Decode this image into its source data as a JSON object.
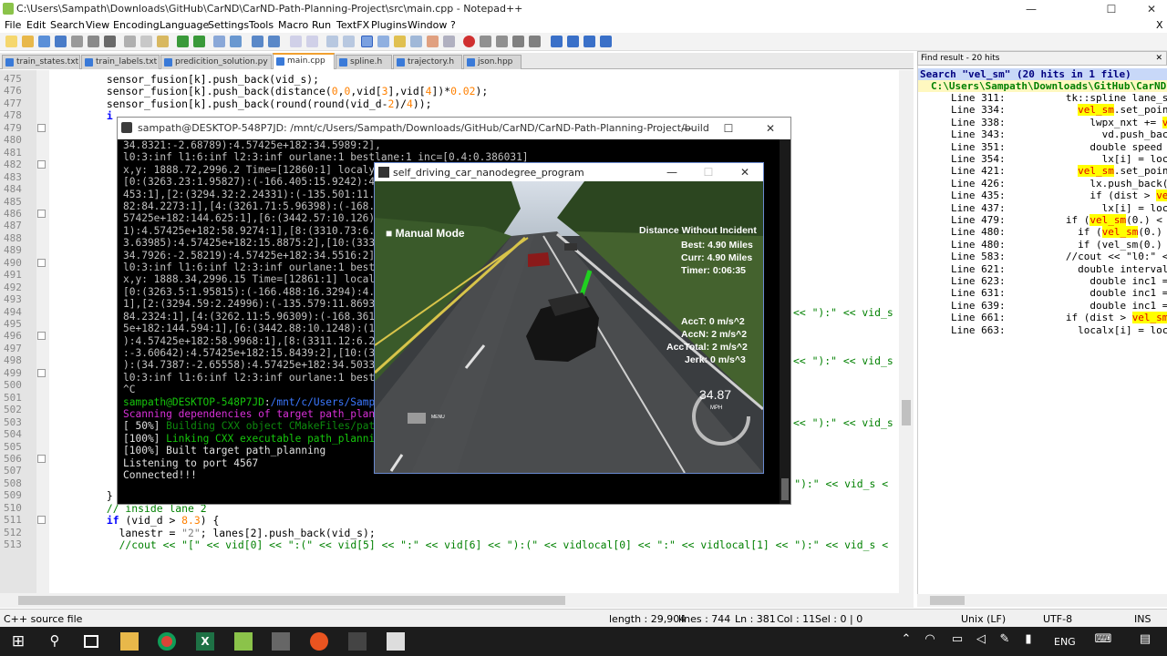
{
  "window": {
    "title": "C:\\Users\\Sampath\\Downloads\\GitHub\\CarND\\CarND-Path-Planning-Project\\src\\main.cpp - Notepad++",
    "minimize": "—",
    "maximize": "☐",
    "close": "✕",
    "extra_close": "X"
  },
  "menu": [
    "File",
    "Edit",
    "Search",
    "View",
    "Encoding",
    "Language",
    "Settings",
    "Tools",
    "Macro",
    "Run",
    "TextFX",
    "Plugins",
    "Window",
    "?"
  ],
  "tabs": [
    "train_states.txt",
    "train_labels.txt",
    "predicition_solution.py",
    "main.cpp",
    "spline.h",
    "trajectory.h",
    "json.hpp"
  ],
  "editor": {
    "lines": [
      {
        "n": "475",
        "segs": [
          [
            "",
            "        sensor_fusion[k].push_back(vid_s);"
          ]
        ]
      },
      {
        "n": "476",
        "segs": [
          [
            "",
            "        sensor_fusion[k].push_back(distance("
          ],
          [
            "nm",
            "0"
          ],
          [
            "",
            ","
          ],
          [
            "nm",
            "0"
          ],
          [
            "",
            ",vid["
          ],
          [
            "nm",
            "3"
          ],
          [
            "",
            "],vid["
          ],
          [
            "nm",
            "4"
          ],
          [
            "",
            "])*"
          ],
          [
            "nm",
            "0.02"
          ],
          [
            "",
            ");"
          ]
        ]
      },
      {
        "n": "477",
        "segs": [
          [
            "",
            "        sensor_fusion[k].push_back(round(round(vid_d-"
          ],
          [
            "nm",
            "2"
          ],
          [
            "",
            ")/"
          ],
          [
            "nm",
            "4"
          ],
          [
            "",
            "));"
          ]
        ]
      },
      {
        "n": "478",
        "segs": [
          [
            "",
            "        "
          ],
          [
            "kw",
            "i"
          ]
        ]
      },
      {
        "n": "479",
        "segs": []
      },
      {
        "n": "480",
        "segs": []
      },
      {
        "n": "481",
        "segs": []
      },
      {
        "n": "482",
        "segs": []
      },
      {
        "n": "483",
        "segs": []
      },
      {
        "n": "484",
        "segs": []
      },
      {
        "n": "485",
        "segs": []
      },
      {
        "n": "486",
        "segs": []
      },
      {
        "n": "487",
        "segs": []
      },
      {
        "n": "488",
        "segs": []
      },
      {
        "n": "489",
        "segs": []
      },
      {
        "n": "490",
        "segs": []
      },
      {
        "n": "491",
        "segs": []
      },
      {
        "n": "492",
        "segs": []
      },
      {
        "n": "493",
        "segs": []
      },
      {
        "n": "494",
        "segs": []
      },
      {
        "n": "495",
        "segs": []
      },
      {
        "n": "496",
        "segs": []
      },
      {
        "n": "497",
        "segs": []
      },
      {
        "n": "498",
        "segs": []
      },
      {
        "n": "499",
        "segs": []
      },
      {
        "n": "500",
        "segs": []
      },
      {
        "n": "501",
        "segs": []
      },
      {
        "n": "502",
        "segs": []
      },
      {
        "n": "503",
        "segs": []
      },
      {
        "n": "504",
        "segs": []
      },
      {
        "n": "505",
        "segs": []
      },
      {
        "n": "506",
        "segs": []
      },
      {
        "n": "507",
        "segs": [
          [
            "",
            "          lanestr = "
          ],
          [
            "st",
            "\"1,2\""
          ],
          [
            "",
            "; lanes[1].push_back(vid_s); lanes[2].push_back(vid_s);"
          ]
        ]
      },
      {
        "n": "508",
        "segs": [
          [
            "cm",
            "          //cout << \"[\" << vid[0] << \":(\" << vid[5] << \":\" << vid[6] << \"):(\" << vidlocal[0] << \":\" << vidlocal[1] << \"):\" << vid_s <"
          ]
        ]
      },
      {
        "n": "509",
        "segs": [
          [
            "",
            "        }"
          ]
        ]
      },
      {
        "n": "510",
        "segs": [
          [
            "cm",
            "        // inside lane 2"
          ]
        ]
      },
      {
        "n": "511",
        "segs": [
          [
            "",
            "        "
          ],
          [
            "kw",
            "if"
          ],
          [
            "",
            " (vid_d > "
          ],
          [
            "nm",
            "8.3"
          ],
          [
            "",
            ") {"
          ]
        ]
      },
      {
        "n": "512",
        "segs": [
          [
            "",
            "          lanestr = "
          ],
          [
            "st",
            "\"2\""
          ],
          [
            "",
            "; lanes[2].push_back(vid_s);"
          ]
        ]
      },
      {
        "n": "513",
        "segs": [
          [
            "cm",
            "          //cout << \"[\" << vid[0] << \":(\" << vid[5] << \":\" << vid[6] << \"):(\" << vidlocal[0] << \":\" << vidlocal[1] << \"):\" << vid_s <"
          ]
        ]
      }
    ],
    "tails": [
      {
        "n": "494",
        "t": "<< \"):\" << vid_s <"
      },
      {
        "n": "498",
        "t": "<< \"):\" << vid_s <"
      },
      {
        "n": "503",
        "t": "<< \"):\" << vid_s <"
      }
    ]
  },
  "find": {
    "header": "Find result - 20 hits",
    "search": "Search \"vel_sm\" (20 hits in 1 file)",
    "file": "C:\\Users\\Sampath\\Downloads\\GitHub\\CarND\\Ca",
    "hits": [
      {
        "line": "Line 311:",
        "pre": "          tk::spline lane_sm,",
        "hit": "",
        "post": ""
      },
      {
        "line": "Line 334:",
        "pre": "            ",
        "hit": "vel_sm",
        "post": ".set_points"
      },
      {
        "line": "Line 338:",
        "pre": "              lwpx_nxt += ",
        "hit": "vel_",
        "post": ""
      },
      {
        "line": "Line 343:",
        "pre": "                vd.push_back(",
        "hit": "v",
        "post": ""
      },
      {
        "line": "Line 351:",
        "pre": "              double speed = ",
        "hit": "v",
        "post": ""
      },
      {
        "line": "Line 354:",
        "pre": "                lx[i] = local",
        "hit": "",
        "post": ""
      },
      {
        "line": "Line 421:",
        "pre": "            ",
        "hit": "vel_sm",
        "post": ".set_points"
      },
      {
        "line": "Line 426:",
        "pre": "              lx.push_back(lx",
        "hit": "",
        "post": ""
      },
      {
        "line": "Line 435:",
        "pre": "              if (dist > ",
        "hit": "vel_s",
        "post": ""
      },
      {
        "line": "Line 437:",
        "pre": "                lx[i] = localx",
        "hit": "",
        "post": ""
      },
      {
        "line": "Line 479:",
        "pre": "          if (",
        "hit": "vel_sm",
        "post": "(0.) < c"
      },
      {
        "line": "Line 480:",
        "pre": "            if (",
        "hit": "vel_sm",
        "post": "(0.) -"
      },
      {
        "line": "Line 480:",
        "pre": "            if (vel_sm(0.) -",
        "hit": "",
        "post": ""
      },
      {
        "line": "Line 583:",
        "pre": "          //cout << \"l0:\" << l",
        "hit": "",
        "post": ""
      },
      {
        "line": "Line 621:",
        "pre": "            double interval",
        "hit": "",
        "post": ""
      },
      {
        "line": "Line 623:",
        "pre": "              double inc1 =",
        "hit": "",
        "post": ""
      },
      {
        "line": "Line 631:",
        "pre": "              double inc1 =",
        "hit": "",
        "post": ""
      },
      {
        "line": "Line 639:",
        "pre": "              double inc1 =",
        "hit": "",
        "post": ""
      },
      {
        "line": "Line 661:",
        "pre": "          if (dist > ",
        "hit": "vel_sm",
        "post": ""
      },
      {
        "line": "Line 663:",
        "pre": "            localx[i] = loc",
        "hit": "",
        "post": ""
      }
    ]
  },
  "status": {
    "type": "C++ source file",
    "length": "length : 29,904",
    "lines": "lines : 744",
    "pos": "Ln : 381",
    "col": "Col : 11",
    "sel": "Sel : 0 | 0",
    "eol": "Unix (LF)",
    "enc": "UTF-8",
    "mode": "INS"
  },
  "terminal": {
    "title": "sampath@DESKTOP-548P7JD: /mnt/c/Users/Sampath/Downloads/GitHub/CarND/CarND-Path-Planning-Project/build",
    "lines": [
      {
        "c": "",
        "t": "34.8321:-2.68789):4.57425e+182:34.5989:2],"
      },
      {
        "c": "",
        "t": "l0:3:inf l1:6:inf l2:3:inf ourlane:1 bestlane:1 inc=[0.4:0.386031]"
      },
      {
        "c": "",
        "t": "x,y: 1888.72,2996.2 Time=[12860:1] localy=[-0."
      },
      {
        "c": "",
        "t": "[0:(3263.23:1.95827):(-166.405:15.9242):4.5742"
      },
      {
        "c": "",
        "t": "453:1],[2:(3294.32:2.24331):(-135.501:11.5351)"
      },
      {
        "c": "",
        "t": "82:84.2273:1],[4:(3261.71:5.96398):(-168.402:1"
      },
      {
        "c": "",
        "t": "57425e+182:144.625:1],[6:(3442.57:10.126):(12."
      },
      {
        "c": "",
        "t": "1):4.57425e+182:58.9274:1],[8:(3310.73:6.26561"
      },
      {
        "c": "",
        "t": "3.63985):4.57425e+182:15.8875:2],[10:(3332.26"
      },
      {
        "c": "",
        "t": "34.7926:-2.58219):4.57425e+182:34.5516:2],"
      },
      {
        "c": "",
        "t": "l0:3:inf l1:6:inf l2:3:inf ourlane:1 bestlane:"
      },
      {
        "c": "",
        "t": "x,y: 1888.34,2996.15 Time=[12861:1] localy=[0."
      },
      {
        "c": "",
        "t": "[0:(3263.5:1.95815):(-166.488:16.3294):4.57425"
      },
      {
        "c": "",
        "t": "1],[2:(3294.59:2.24996):(-135.579:11.8693):4.5"
      },
      {
        "c": "",
        "t": "84.2324:1],[4:(3262.11:5.96309):(-168.361:12.5"
      },
      {
        "c": "",
        "t": "5e+182:144.594:1],[6:(3442.88:10.1248):(12.832"
      },
      {
        "c": "",
        "t": "):4.57425e+182:58.9968:1],[8:(3311.12:6.26049)"
      },
      {
        "c": "",
        "t": ":-3.60642):4.57425e+182:15.8439:2],[10:(3332.6"
      },
      {
        "c": "",
        "t": "):(34.7387:-2.65558):4.57425e+182:34.5033:2],"
      },
      {
        "c": "",
        "t": "l0:3:inf l1:6:inf l2:3:inf ourlane:1 bestlane:"
      },
      {
        "c": "",
        "t": "^C"
      },
      {
        "c": "prompt",
        "t": "sampath@DESKTOP-548P7JD:/mnt/c/Users/Sampath/D"
      },
      {
        "c": "m",
        "t": "Scanning dependencies of target path_planning"
      },
      {
        "c": "mix1",
        "t": "[ 50%] Building CXX object CMakeFiles/path_pla"
      },
      {
        "c": "mix2",
        "t": "[100%] Linking CXX executable path_planning"
      },
      {
        "c": "w",
        "t": "[100%] Built target path_planning"
      },
      {
        "c": "w",
        "t": "Listening to port 4567"
      },
      {
        "c": "w",
        "t": "Connected!!!"
      }
    ]
  },
  "sim": {
    "title": "self_driving_car_nanodegree_program",
    "mode": "Manual Mode",
    "incident_title": "Distance Without Incident",
    "best": "Best: 4.90 Miles",
    "curr": "Curr: 4.90 Miles",
    "timer": "Timer: 0:06:35",
    "acct": "AccT: 0 m/s^2",
    "accn": "AccN: 2 m/s^2",
    "acctotal": "AccTotal: 2 m/s^2",
    "jerk": "Jerk: 0 m/s^3",
    "speed": "34.87",
    "speed_unit": "MPH",
    "menu": "MENU"
  },
  "taskbar": {
    "lang": "ENG"
  }
}
